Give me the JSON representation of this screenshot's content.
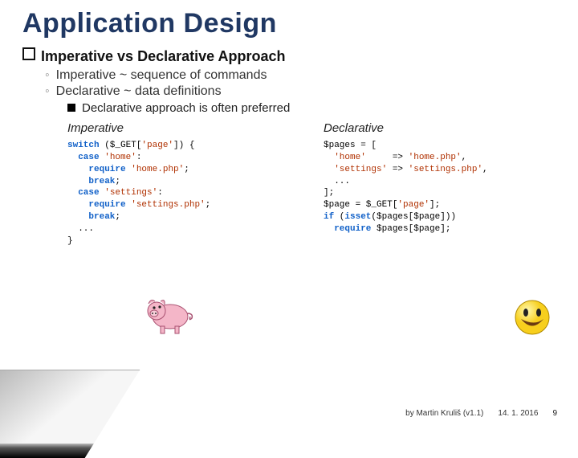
{
  "title": "Application Design",
  "heading": {
    "prefix": "Imperative",
    "rest": " vs Declarative Approach"
  },
  "bullets2": [
    "Imperative ~ sequence of commands",
    "Declarative ~ data definitions"
  ],
  "bullet3": "Declarative approach is often preferred",
  "columns": {
    "left": {
      "head": "Imperative",
      "code_html": "<span class=\"kw\">switch</span> ($_GET[<span class=\"str\">'page'</span>]) {\n  <span class=\"kw\">case</span> <span class=\"str\">'home'</span>:\n    <span class=\"kw\">require</span> <span class=\"str\">'home.php'</span>;\n    <span class=\"kw\">break</span>;\n  <span class=\"kw\">case</span> <span class=\"str\">'settings'</span>:\n    <span class=\"kw\">require</span> <span class=\"str\">'settings.php'</span>;\n    <span class=\"kw\">break</span>;\n  ...\n}"
    },
    "right": {
      "head": "Declarative",
      "code_html": "$pages = [\n  <span class=\"str\">'home'</span>     =&gt; <span class=\"str\">'home.php'</span>,\n  <span class=\"str\">'settings'</span> =&gt; <span class=\"str\">'settings.php'</span>,\n  ...\n];\n$page = $_GET[<span class=\"str\">'page'</span>];\n<span class=\"kw\">if</span> (<span class=\"kw\">isset</span>($pages[$page]))\n  <span class=\"kw\">require</span> $pages[$page];"
    }
  },
  "footer": {
    "by": "by Martin Kruliš (v1.1)",
    "date": "14. 1. 2016",
    "page": "9"
  },
  "icons": {
    "pig": "pig-image",
    "smile": "smiley-image"
  }
}
